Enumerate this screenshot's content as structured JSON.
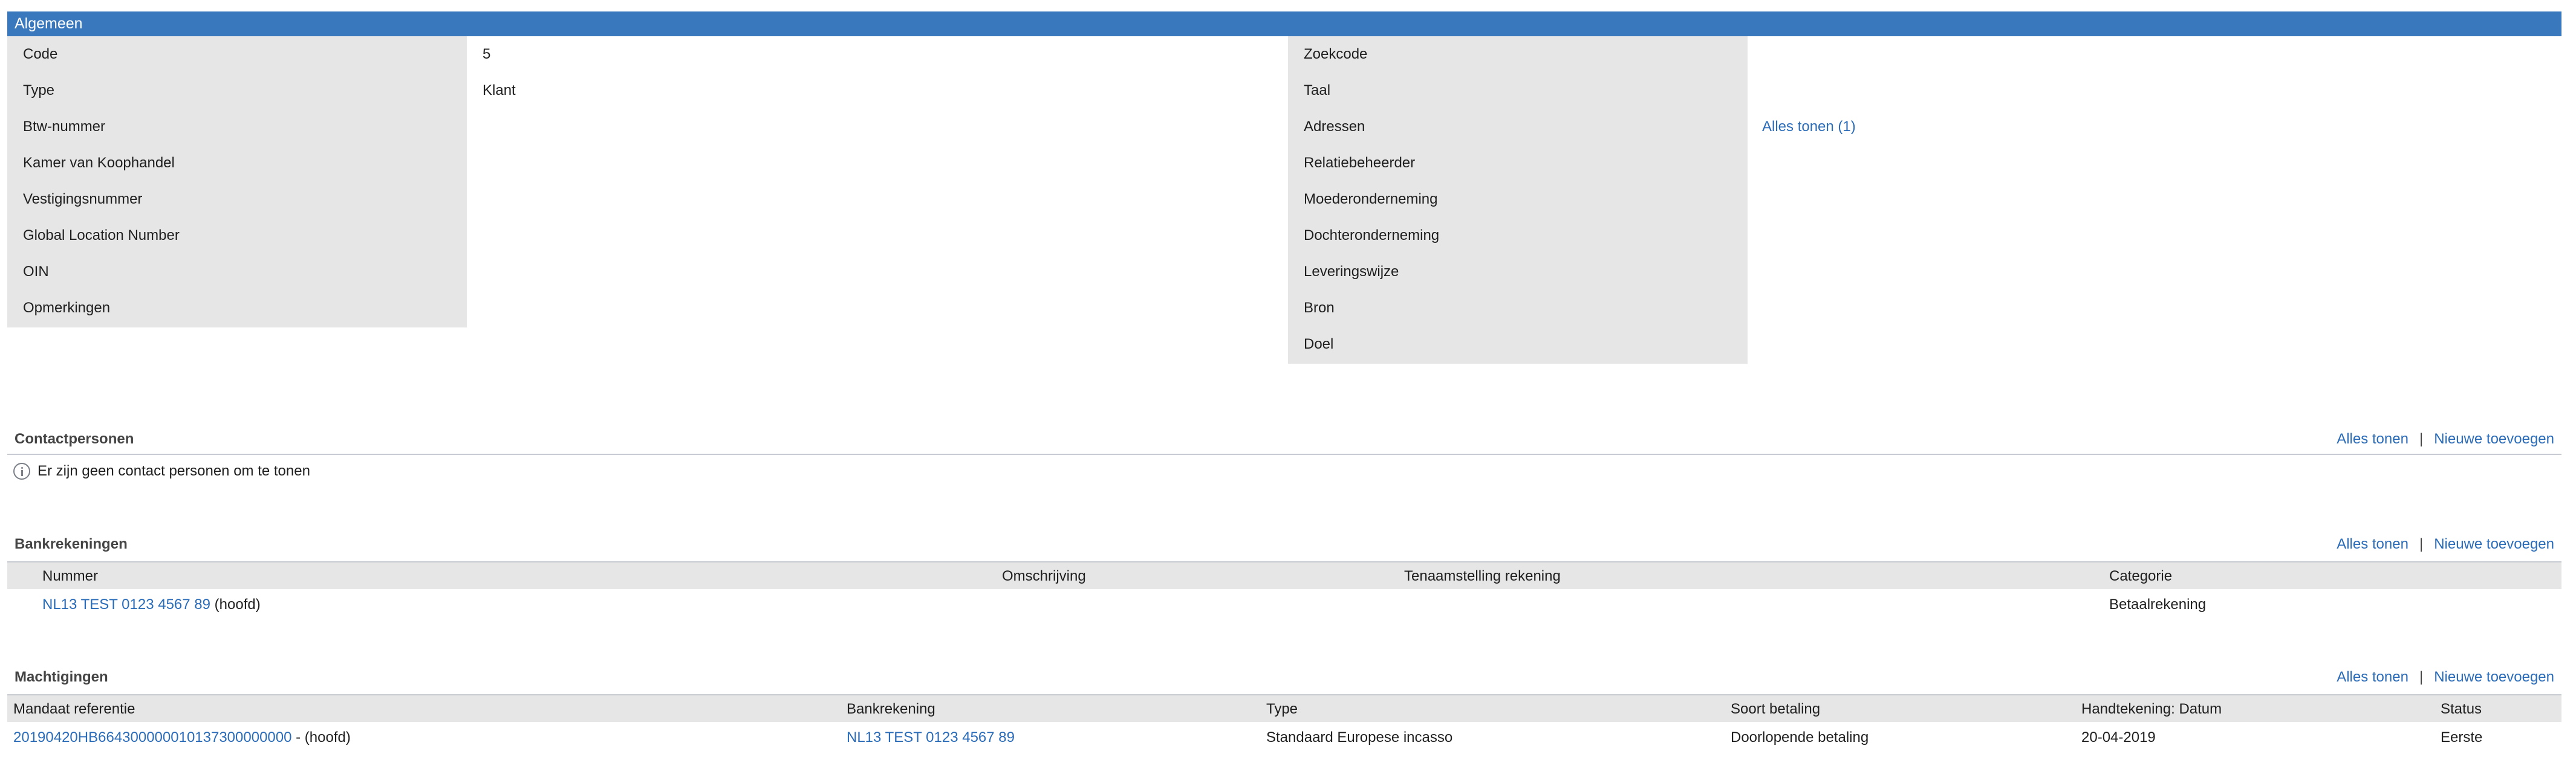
{
  "general": {
    "title": "Algemeen",
    "left_labels": [
      "Code",
      "Type",
      "Btw-nummer",
      "Kamer van Koophandel",
      "Vestigingsnummer",
      "Global Location Number",
      "OIN",
      "Opmerkingen"
    ],
    "left_values": [
      "5",
      "Klant",
      "",
      "",
      "",
      "",
      "",
      ""
    ],
    "right_labels": [
      "Zoekcode",
      "Taal",
      "Adressen",
      "Relatiebeheerder",
      "Moederonderneming",
      "Dochteronderneming",
      "Leveringswijze",
      "Bron",
      "Doel"
    ],
    "addresses_link": "Alles tonen (1)"
  },
  "contacts": {
    "title": "Contactpersonen",
    "show_all": "Alles tonen",
    "separator": "|",
    "add_new": "Nieuwe toevoegen",
    "empty_message": "Er zijn geen contact personen om te tonen",
    "icon": "info-icon"
  },
  "bank_accounts": {
    "title": "Bankrekeningen",
    "show_all": "Alles tonen",
    "separator": "|",
    "add_new": "Nieuwe toevoegen",
    "columns": [
      "Nummer",
      "Omschrijving",
      "Tenaamstelling rekening",
      "Categorie"
    ],
    "rows": [
      {
        "number": "NL13 TEST 0123 4567 89",
        "suffix": " (hoofd)",
        "description": "",
        "holder": "",
        "category": "Betaalrekening"
      }
    ]
  },
  "mandates": {
    "title": "Machtigingen",
    "show_all": "Alles tonen",
    "separator": "|",
    "add_new": "Nieuwe toevoegen",
    "columns": [
      "Mandaat referentie",
      "Bankrekening",
      "Type",
      "Soort betaling",
      "Handtekening: Datum",
      "Status"
    ],
    "rows": [
      {
        "reference": "20190420HB664300000010137300000000",
        "ref_suffix": " - (hoofd)",
        "bank_account": "NL13 TEST 0123 4567 89",
        "type": "Standaard Europese incasso",
        "payment_kind": "Doorlopende betaling",
        "signature_date": "20-04-2019",
        "status": "Eerste"
      }
    ]
  },
  "colors": {
    "header_bar": "#3a78bd",
    "label_bg": "#e6e6e6",
    "link": "#2b6cb8"
  }
}
